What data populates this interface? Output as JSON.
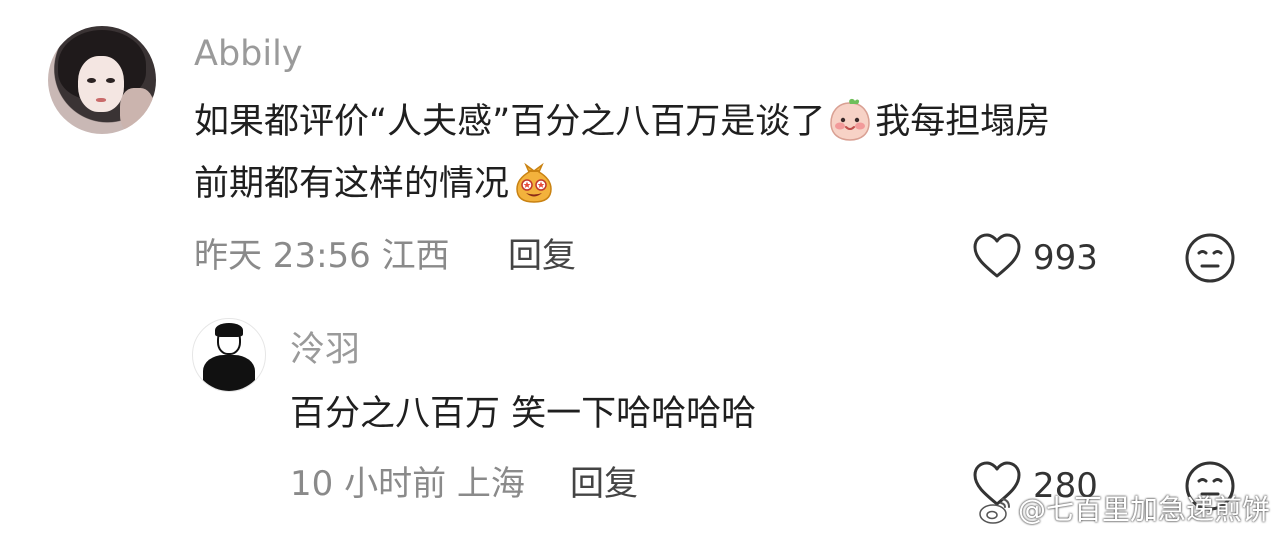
{
  "comments": [
    {
      "author": "Abbily",
      "line1_part1": "如果都评价“人夫感”百分之八百万是谈了",
      "line1_part2": "我每担塌房",
      "line2": "前期都有这样的情况",
      "time": "昨天 23:56",
      "location": "江西",
      "reply_label": "回复",
      "likes": "993"
    },
    {
      "author": "泠羽",
      "text": "百分之八百万 笑一下哈哈哈哈",
      "time": "10 小时前",
      "location": "上海",
      "reply_label": "回复",
      "likes": "280"
    }
  ],
  "watermark": {
    "text": "@七百里加急递煎饼"
  },
  "icons": {
    "like": "heart-outline-icon",
    "dislike": "meh-face-icon",
    "emoji_1": "blushing-peach-emoji",
    "emoji_2": "starry-eyed-money-bag-emoji",
    "watermark": "weibo-logo-icon"
  }
}
